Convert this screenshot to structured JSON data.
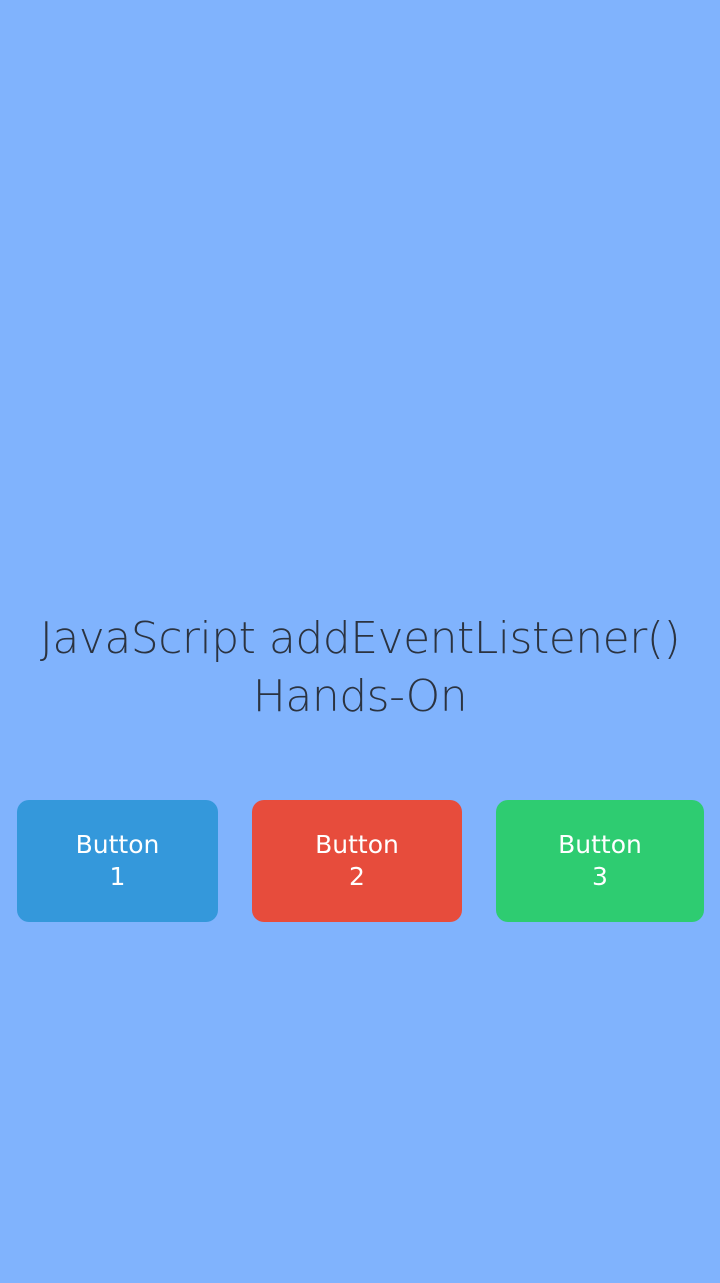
{
  "heading": {
    "line1": "JavaScript addEventListener()",
    "line2": "Hands-On"
  },
  "buttons": [
    {
      "word": "Button",
      "number": "1",
      "color": "#3498db"
    },
    {
      "word": "Button",
      "number": "2",
      "color": "#e74c3c"
    },
    {
      "word": "Button",
      "number": "3",
      "color": "#2ecc71"
    }
  ],
  "colors": {
    "background": "#80b3fd",
    "heading_text": "#2b3340",
    "button_text": "#ffffff"
  }
}
